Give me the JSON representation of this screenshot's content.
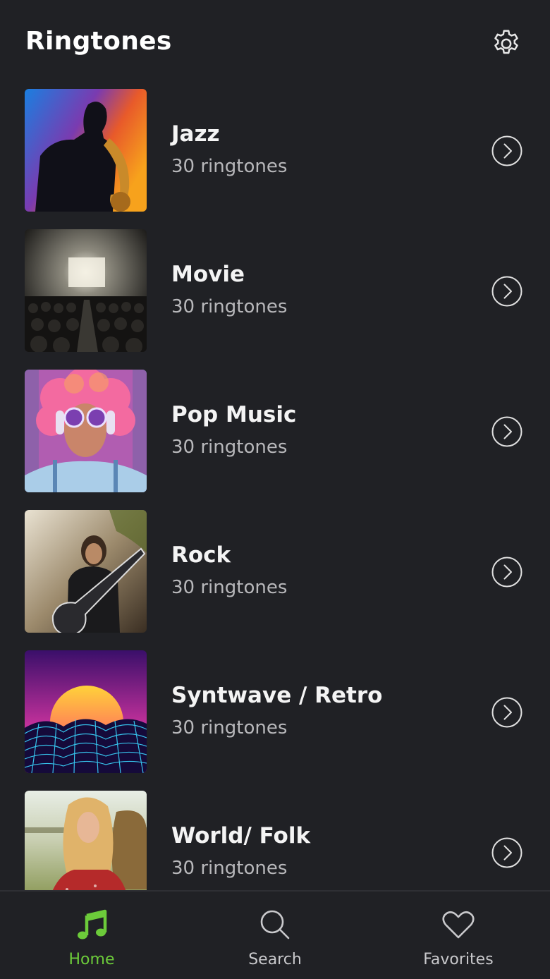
{
  "header": {
    "title": "Ringtones"
  },
  "icons": {
    "settings": "gear-icon",
    "chevron": "chevron-right-circle-icon"
  },
  "colors": {
    "background": "#202125",
    "accent": "#6ccb3a",
    "muted": "#b8b8bb"
  },
  "categories": [
    {
      "name": "Jazz",
      "count": "30 ringtones",
      "thumb": "saxophone-player-image"
    },
    {
      "name": "Movie",
      "count": "30 ringtones",
      "thumb": "movie-theater-image"
    },
    {
      "name": "Pop Music",
      "count": "30 ringtones",
      "thumb": "pop-girl-headphones-image"
    },
    {
      "name": "Rock",
      "count": "30 ringtones",
      "thumb": "rock-guitarist-image"
    },
    {
      "name": "Syntwave / Retro",
      "count": "30 ringtones",
      "thumb": "synthwave-sunset-image"
    },
    {
      "name": "World/ Folk",
      "count": "30 ringtones",
      "thumb": "folk-girl-image"
    }
  ],
  "tabs": [
    {
      "label": "Home",
      "icon": "music-note-icon",
      "active": true
    },
    {
      "label": "Search",
      "icon": "search-icon",
      "active": false
    },
    {
      "label": "Favorites",
      "icon": "heart-icon",
      "active": false
    }
  ]
}
